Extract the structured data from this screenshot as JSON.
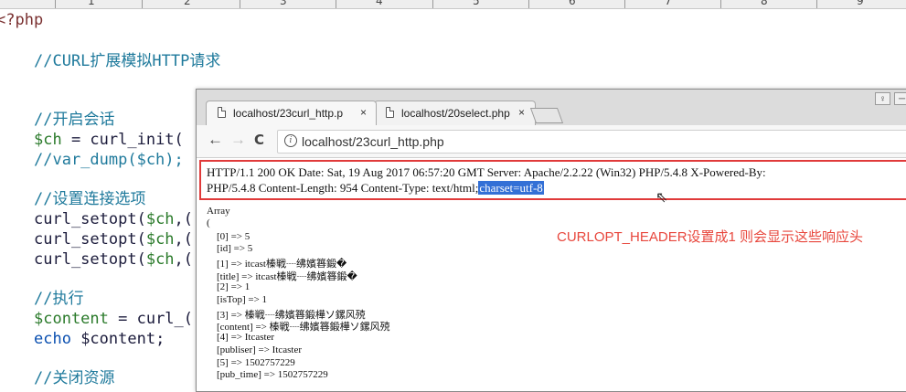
{
  "ruler": {
    "numbers": [
      "1",
      "2",
      "3",
      "4",
      "5",
      "6",
      "7",
      "8",
      "9"
    ]
  },
  "editor": {
    "lines": {
      "php_open": "<?php",
      "comment_curl": "//CURL扩展模拟HTTP请求",
      "comment_open": "//开启会话",
      "ch_var": "$ch",
      "ch_assign": " = curl_init(",
      "var_dump": "//var_dump($ch);",
      "comment_set": "//设置连接选项",
      "setopt_fn": "curl_setopt(",
      "setopt_arg": ",(",
      "comment_exec": "//执行",
      "content_var": "$content",
      "content_assign": " = curl_(",
      "echo_kw": "echo",
      "echo_rest": " $content;",
      "comment_close": "//关闭资源"
    }
  },
  "browser": {
    "tabs": [
      {
        "title": "localhost/23curl_http.p",
        "close": "×"
      },
      {
        "title": "localhost/20select.php",
        "close": "×"
      }
    ],
    "window_buttons": {
      "user": "♀",
      "minimize": "─"
    },
    "nav": {
      "back": "←",
      "forward": "→",
      "reload": "C"
    },
    "address": {
      "info": "i",
      "url": "localhost/23curl_http.php"
    },
    "response_header": {
      "line1": "HTTP/1.1 200 OK Date: Sat, 19 Aug 2017 06:57:20 GMT Server: Apache/2.2.22 (Win32) PHP/5.4.8 X-Powered-By:",
      "line2": "PHP/5.4.8 Content-Length: 954 Content-Type: text/html;",
      "line2_selected": "charset=utf-8"
    },
    "annotation": "CURLOPT_HEADER设置成1 则会显示这些响应头",
    "body_lines": [
      "Array",
      "(",
      "    [0] => 5",
      "    [id] => 5",
      "    [1] => itcast榛戦┈绋嬪簭鍛�",
      "    [title] => itcast榛戦┈绋嬪簭鍛�",
      "    [2] => 1",
      "    [isTop] => 1",
      "    [3] => 榛戦┈绋嬪簭鍛樺ソ鏍风殑",
      "    [content] => 榛戦┈绋嬪簭鍛樺ソ鏍风殑",
      "    [4] => Itcaster",
      "    [publiser] => Itcaster",
      "    [5] => 1502757229",
      "    [pub_time] => 1502757229"
    ]
  }
}
